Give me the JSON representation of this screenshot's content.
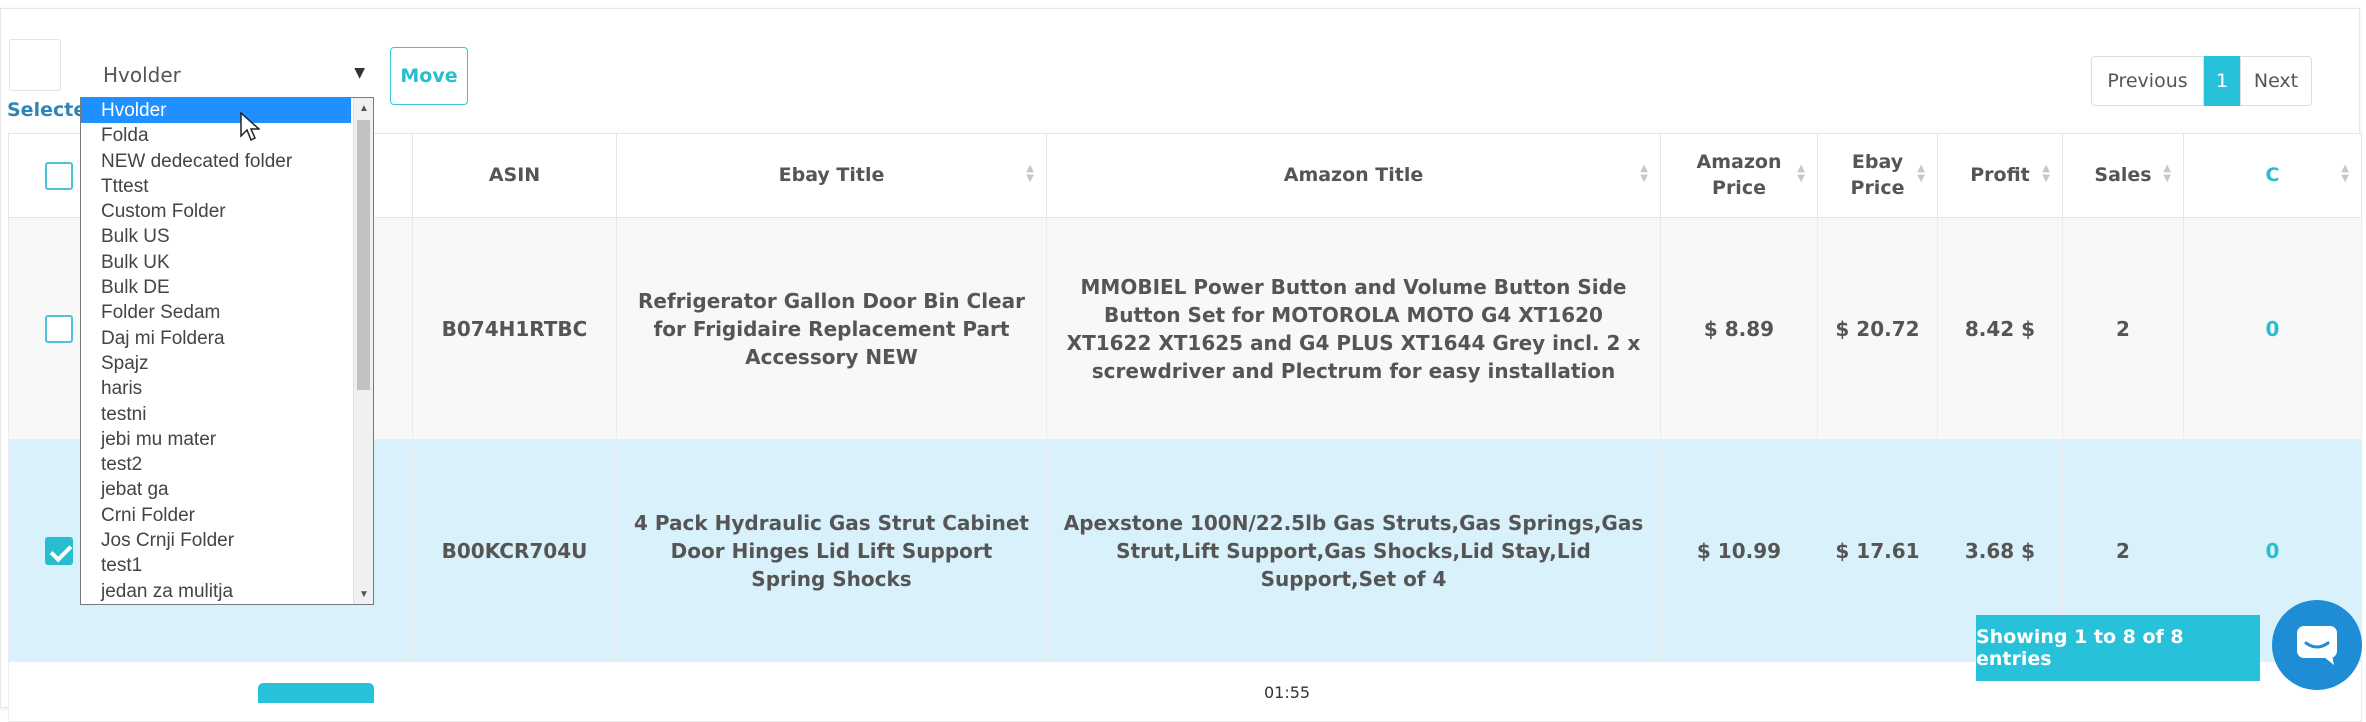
{
  "toolbar": {
    "folder_select_value": "Hvolder",
    "move_label": "Move",
    "selected_info": "Selected Count of Prit..."
  },
  "pagination": {
    "previous": "Previous",
    "current": "1",
    "next": "Next"
  },
  "dropdown": {
    "options": [
      "Hvolder",
      "Folda",
      "NEW dedecated folder",
      "Tttest",
      "Custom Folder",
      "Bulk US",
      "Bulk UK",
      "Bulk DE",
      "Folder Sedam",
      "Daj mi Foldera",
      "Spajz",
      "haris",
      "testni",
      "jebi mu mater",
      "test2",
      "jebat ga",
      "Crni Folder",
      "Jos Crnji Folder",
      "test1",
      "jedan za mulitja"
    ],
    "highlighted": "Hvolder"
  },
  "table": {
    "headers": {
      "asin": "ASIN",
      "ebay_title": "Ebay Title",
      "amazon_title": "Amazon Title",
      "amazon_price": "Amazon Price",
      "ebay_price": "Ebay Price",
      "profit": "Profit",
      "sales": "Sales",
      "c": "C"
    },
    "rows": [
      {
        "checked": false,
        "asin": "B074H1RTBC",
        "ebay_title": "Refrigerator Gallon Door Bin Clear for Frigidaire Replacement Part Accessory NEW",
        "amazon_title": "MMOBIEL Power Button and Volume Button Side Button Set for MOTOROLA MOTO G4 XT1620 XT1622 XT1625 and G4 PLUS XT1644 Grey incl. 2 x screwdriver and Plectrum for easy installation",
        "amazon_price": "$ 8.89",
        "ebay_price": "$ 20.72",
        "profit": "8.42 $",
        "sales": "2",
        "c": "0"
      },
      {
        "checked": true,
        "asin": "B00KCR704U",
        "ebay_title": "4 Pack Hydraulic Gas Strut Cabinet Door Hinges Lid Lift Support Spring Shocks",
        "amazon_title": "Apexstone 100N/22.5lb Gas Struts,Gas Springs,Gas Strut,Lift Support,Gas Shocks,Lid Stay,Lid Support,Set of 4",
        "amazon_price": "$ 10.99",
        "ebay_price": "$ 17.61",
        "profit": "3.68 $",
        "sales": "2",
        "c": "0"
      }
    ]
  },
  "footer": {
    "showing": "Showing 1 to 8 of 8 entries",
    "timer": "01:55"
  },
  "colors": {
    "accent": "#27c2d9",
    "selected_row": "#d9f1fa",
    "dropdown_highlight": "#1e90ff",
    "chat_button": "#1f8cd6"
  },
  "icons": {
    "chat": "chat-bubble-icon",
    "sort": "sort-arrows-icon",
    "cursor": "mouse-pointer-icon"
  }
}
